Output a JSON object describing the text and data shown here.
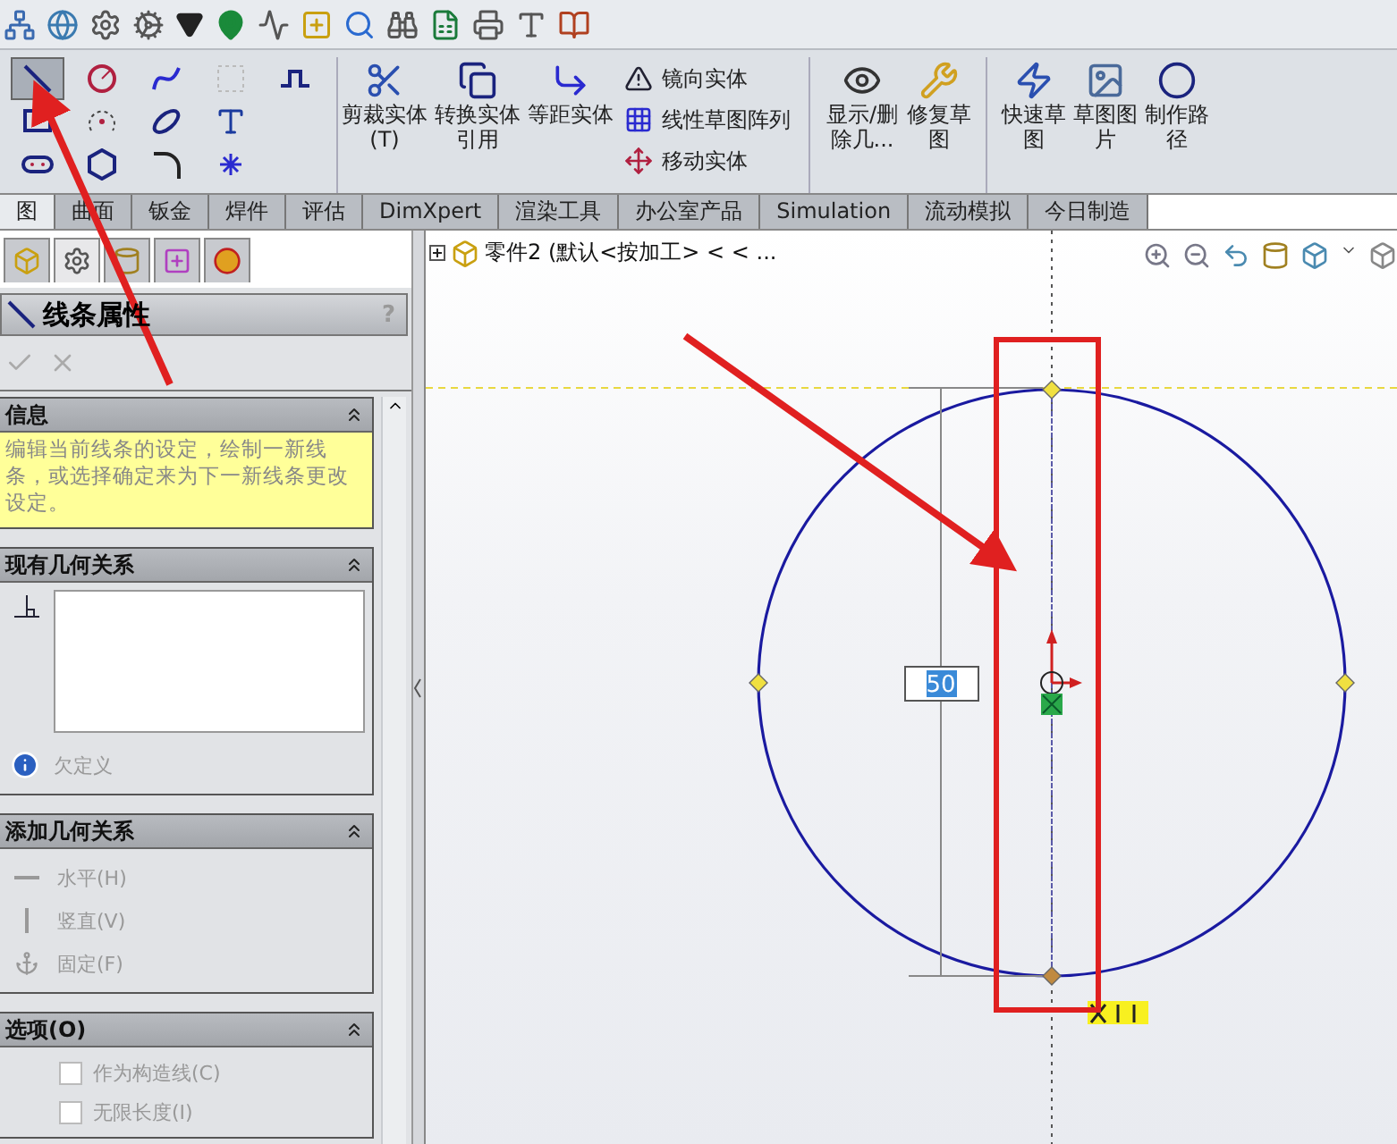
{
  "sketch_tools": [
    {
      "kind": "line",
      "selected": true
    },
    {
      "kind": "rectangle",
      "selected": false
    },
    {
      "kind": "slot",
      "selected": false
    },
    {
      "kind": "circle",
      "selected": false
    },
    {
      "kind": "arc",
      "selected": false
    },
    {
      "kind": "polygon",
      "selected": false
    },
    {
      "kind": "spline",
      "selected": false
    },
    {
      "kind": "ellipse",
      "selected": false
    },
    {
      "kind": "fillet",
      "selected": false
    },
    {
      "kind": "grid",
      "selected": false
    },
    {
      "kind": "text",
      "selected": false
    },
    {
      "kind": "point",
      "selected": false
    },
    {
      "kind": "step",
      "selected": false
    }
  ],
  "commands": [
    {
      "label": "剪裁实体(T)"
    },
    {
      "label": "转换实体引用"
    },
    {
      "label": "等距实体"
    }
  ],
  "command_list": [
    "镜向实体",
    "线性草图阵列",
    "移动实体"
  ],
  "commands_right": [
    {
      "kind": "big",
      "label": "显示/删除几..."
    },
    {
      "kind": "big",
      "label": "修复草图"
    },
    {
      "kind": "sep"
    },
    {
      "kind": "big",
      "label": "快速草图"
    },
    {
      "kind": "big",
      "label": "草图图片"
    },
    {
      "kind": "big",
      "label": "制作路径"
    }
  ],
  "tabs": [
    {
      "label": "图",
      "selected": true
    },
    {
      "label": "曲面",
      "selected": false
    },
    {
      "label": "钣金",
      "selected": false
    },
    {
      "label": "焊件",
      "selected": false
    },
    {
      "label": "评估",
      "selected": false
    },
    {
      "label": "DimXpert",
      "selected": false
    },
    {
      "label": "渲染工具",
      "selected": false
    },
    {
      "label": "办公室产品",
      "selected": false
    },
    {
      "label": "Simulation",
      "selected": false
    },
    {
      "label": "流动模拟",
      "selected": false
    },
    {
      "label": "今日制造",
      "selected": false
    }
  ],
  "panel_tabs": [
    {
      "kind": "part",
      "selected": false
    },
    {
      "kind": "property",
      "selected": true
    },
    {
      "kind": "config",
      "selected": false
    },
    {
      "kind": "dimension",
      "selected": false
    },
    {
      "kind": "appearance",
      "selected": false
    }
  ],
  "panel": {
    "title": "线条属性",
    "help": "?",
    "sections": [
      {
        "kind": "info",
        "title": "信息",
        "text": "编辑当前线条的设定，绘制一新线条，或选择确定来为下一新线条更改设定。"
      },
      {
        "kind": "relations",
        "title": "现有几何关系",
        "status": "欠定义"
      },
      {
        "kind": "add",
        "title": "添加几何关系",
        "items": [
          {
            "kind": "horizontal",
            "label": "水平(H)",
            "disabled": true
          },
          {
            "kind": "vertical",
            "label": "竖直(V)",
            "disabled": true
          },
          {
            "kind": "fixed",
            "label": "固定(F)",
            "disabled": true
          }
        ]
      },
      {
        "kind": "options",
        "title": "选项(O)",
        "options": [
          {
            "label": "作为构造线(C)",
            "checked": false,
            "disabled": true
          },
          {
            "label": "无限长度(I)",
            "checked": false,
            "disabled": true
          }
        ]
      }
    ]
  },
  "canvas": {
    "tree_label": "零件2  (默认<按加工> < < ...",
    "dimension": "50"
  }
}
